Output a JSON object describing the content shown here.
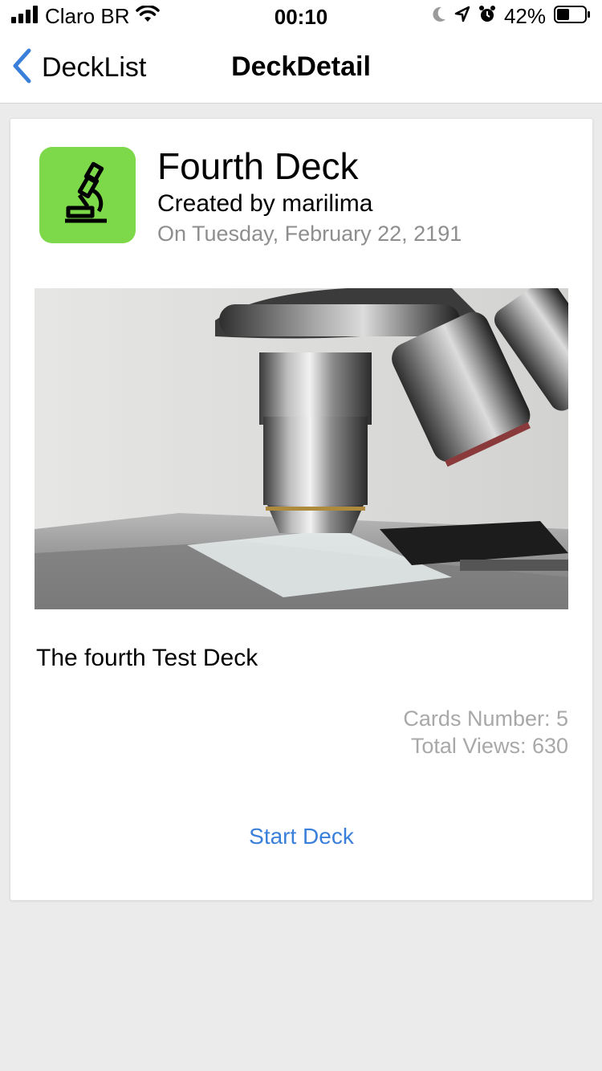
{
  "status_bar": {
    "carrier": "Claro BR",
    "time": "00:10",
    "battery": "42%",
    "icons": [
      "signal-icon",
      "wifi-icon",
      "moon-icon",
      "location-icon",
      "alarm-icon",
      "battery-icon"
    ]
  },
  "nav": {
    "back_label": "DeckList",
    "title": "DeckDetail"
  },
  "deck": {
    "icon": "microscope-icon",
    "icon_color": "#7dd94a",
    "title": "Fourth Deck",
    "author": "Created by marilima",
    "date": "On Tuesday, February 22, 2191",
    "description": "The fourth Test Deck",
    "cards_number": "Cards Number: 5",
    "total_views": "Total Views: 630",
    "start_label": "Start Deck",
    "accent": "#3a7fd9"
  }
}
